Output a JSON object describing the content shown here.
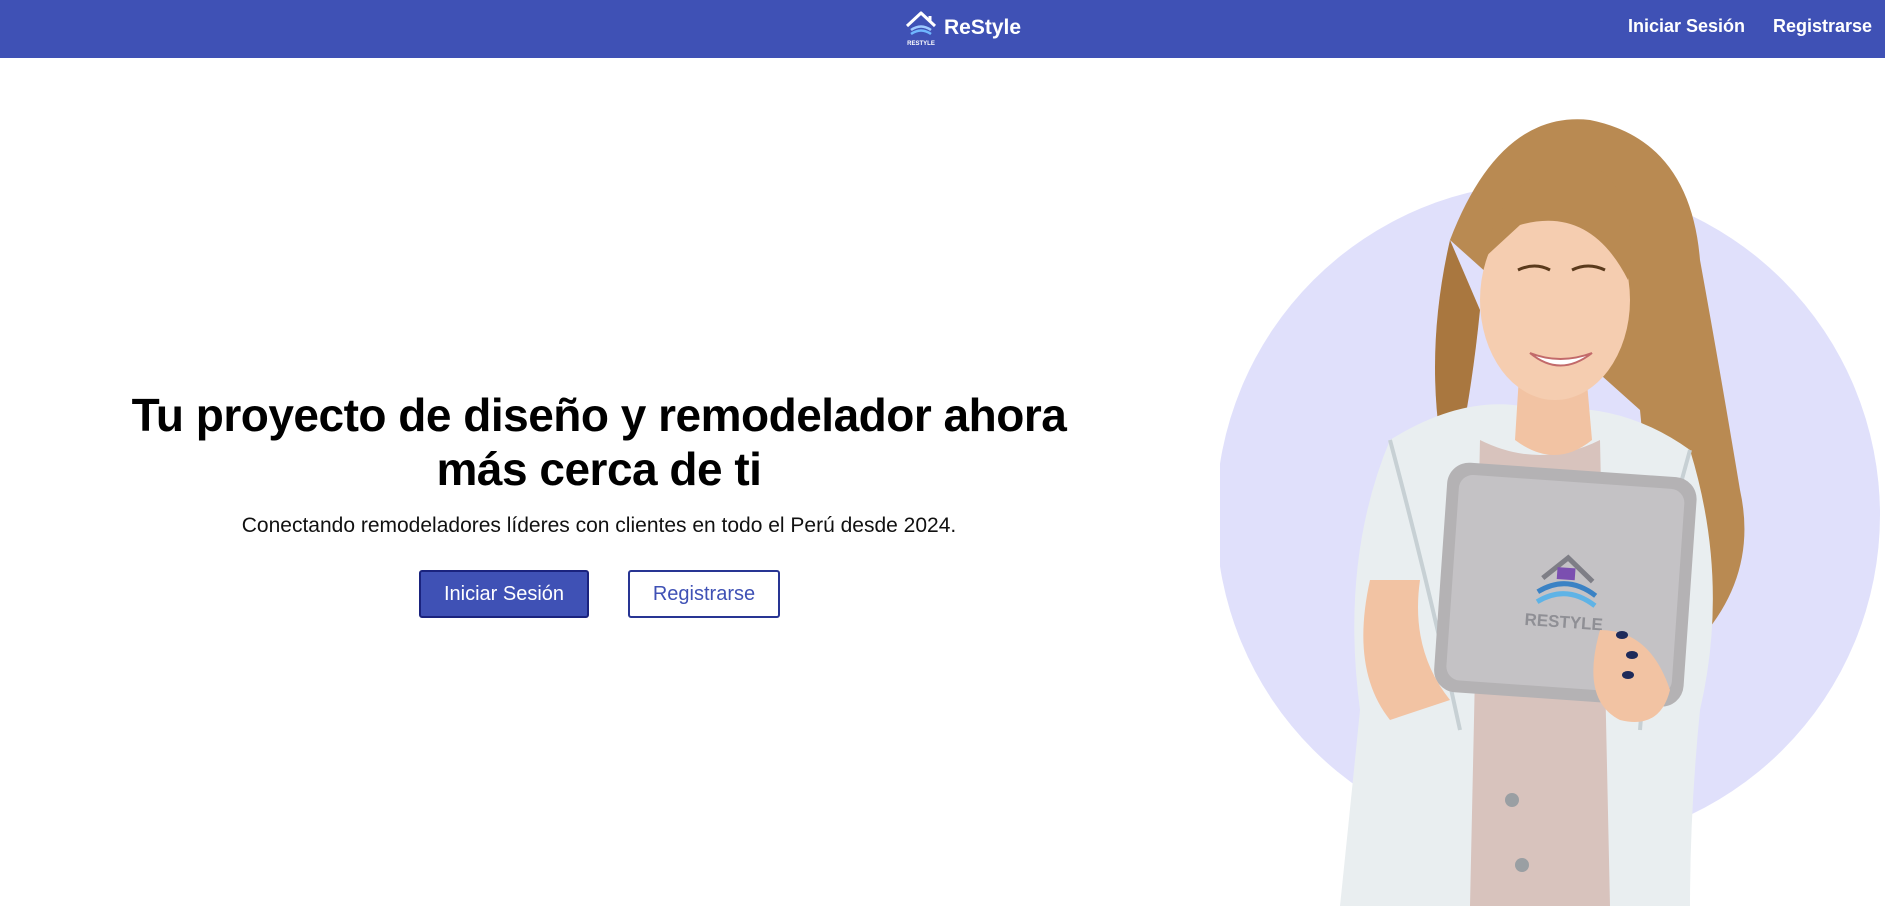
{
  "navbar": {
    "brand_name": "ReStyle",
    "logo_text": "RESTYLE",
    "links": {
      "login": "Iniciar Sesión",
      "register": "Registrarse"
    }
  },
  "hero": {
    "title": "Tu proyecto de diseño y remodelador ahora más cerca de ti",
    "subtitle": "Conectando remodeladores líderes con clientes en todo el Perú desde 2024.",
    "buttons": {
      "login": "Iniciar Sesión",
      "register": "Registrarse"
    },
    "tablet_logo_text": "RESTYLE"
  },
  "colors": {
    "primary": "#3f51b5",
    "primary_border": "#1a237e",
    "circle": "#e0e0fb",
    "text": "#000000"
  },
  "icons": {
    "brand_logo": "house-logo-icon",
    "hero_image": "woman-with-tablet-illustration"
  }
}
